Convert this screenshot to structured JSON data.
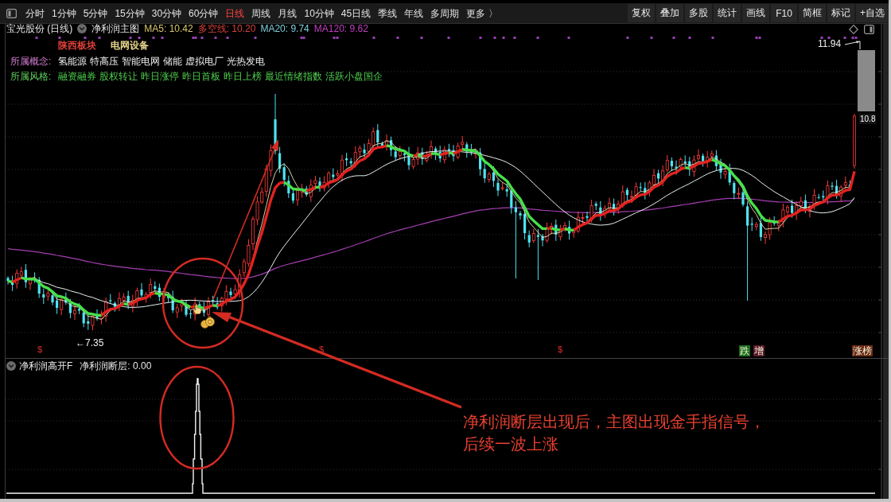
{
  "toolbar": {
    "periods": [
      {
        "label": "分时",
        "selected": false
      },
      {
        "label": "1分钟",
        "selected": false
      },
      {
        "label": "5分钟",
        "selected": false
      },
      {
        "label": "15分钟",
        "selected": false
      },
      {
        "label": "30分钟",
        "selected": false
      },
      {
        "label": "60分钟",
        "selected": false
      },
      {
        "label": "日线",
        "selected": true
      },
      {
        "label": "周线",
        "selected": false
      },
      {
        "label": "月线",
        "selected": false
      },
      {
        "label": "10分钟",
        "selected": false
      },
      {
        "label": "45日线",
        "selected": false
      },
      {
        "label": "季线",
        "selected": false
      },
      {
        "label": "年线",
        "selected": false
      },
      {
        "label": "多周期",
        "selected": false
      },
      {
        "label": "更多 〉",
        "selected": false
      }
    ],
    "buttons": [
      "复权",
      "叠加",
      "多股",
      "统计",
      "画线",
      "F10",
      "简框",
      "标记",
      "+自选"
    ]
  },
  "main_chart": {
    "title": "宝光股份 (日线)",
    "indicator": "净利润主图",
    "readings": [
      {
        "label": "MA5: 10.42",
        "color": "#d9c56b"
      },
      {
        "label": "多空线: 10.20",
        "color": "#d8413b"
      },
      {
        "label": "MA20: 9.74",
        "color": "#7ecfdc"
      },
      {
        "label": "MA120: 9.62",
        "color": "#c23fc2"
      }
    ],
    "sectors": [
      {
        "label": "陕西板块",
        "color": "#e0403a"
      },
      {
        "label": "电网设备",
        "color": "#e6d58c"
      }
    ],
    "concepts": {
      "label": "所属概念:",
      "items": [
        "氢能源",
        "特高压",
        "智能电网",
        "储能",
        "虚拟电厂",
        "光热发电"
      ]
    },
    "styles": {
      "label": "所属风格:",
      "items": [
        "融资融券",
        "股权转让",
        "昨日涨停",
        "昨日首板",
        "昨日上榜",
        "最近情绪指数",
        "活跃小盘国企"
      ]
    },
    "high_label": "11.94",
    "low_label": "←7.35",
    "price_tag": "10.8",
    "signal_marks": [
      "$",
      "$",
      "$"
    ],
    "event_badges": [
      {
        "text": "跌",
        "color": "#1b6e1b"
      },
      {
        "text": "增",
        "color": "#5a1a2a"
      },
      {
        "text": "涨榜",
        "color": "#6a2a14"
      }
    ]
  },
  "sub_chart": {
    "indicator": "净利润高开F",
    "reading": "净利润断层: 0.00"
  },
  "annotation": [
    "净利润断层出现后，主图出现金手指信号，",
    "后续一波上涨"
  ]
}
